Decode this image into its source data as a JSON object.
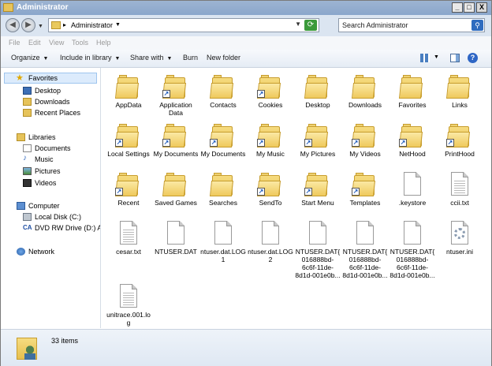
{
  "window": {
    "title": "Administrator"
  },
  "title_buttons": {
    "minimize": "_",
    "maximize": "□",
    "close": "X"
  },
  "address": {
    "path": "Administrator",
    "separator": "▸"
  },
  "search": {
    "placeholder": "Search Administrator"
  },
  "menu": {
    "file": "File",
    "edit": "Edit",
    "view": "View",
    "tools": "Tools",
    "help": "Help"
  },
  "toolbar": {
    "organize": "Organize",
    "include": "Include in library",
    "share": "Share with",
    "burn": "Burn",
    "new_folder": "New folder"
  },
  "sidebar": {
    "favorites": "Favorites",
    "desktop": "Desktop",
    "downloads": "Downloads",
    "recent": "Recent Places",
    "libraries": "Libraries",
    "documents": "Documents",
    "music": "Music",
    "pictures": "Pictures",
    "videos": "Videos",
    "computer": "Computer",
    "local_disk": "Local Disk (C:)",
    "dvd": "DVD RW Drive (D:) AP",
    "network": "Network"
  },
  "files": [
    {
      "name": "AppData",
      "type": "folder"
    },
    {
      "name": "Application Data",
      "type": "folder-shortcut"
    },
    {
      "name": "Contacts",
      "type": "folder"
    },
    {
      "name": "Cookies",
      "type": "folder-shortcut"
    },
    {
      "name": "Desktop",
      "type": "folder"
    },
    {
      "name": "Downloads",
      "type": "folder"
    },
    {
      "name": "Favorites",
      "type": "folder"
    },
    {
      "name": "Links",
      "type": "folder"
    },
    {
      "name": "Local Settings",
      "type": "folder-shortcut"
    },
    {
      "name": "My Documents",
      "type": "folder-shortcut"
    },
    {
      "name": "My Documents",
      "type": "folder-shortcut"
    },
    {
      "name": "My Music",
      "type": "folder-shortcut"
    },
    {
      "name": "My Pictures",
      "type": "folder-shortcut"
    },
    {
      "name": "My Videos",
      "type": "folder-shortcut"
    },
    {
      "name": "NetHood",
      "type": "folder-shortcut"
    },
    {
      "name": "PrintHood",
      "type": "folder-shortcut"
    },
    {
      "name": "Recent",
      "type": "folder-shortcut"
    },
    {
      "name": "Saved Games",
      "type": "folder"
    },
    {
      "name": "Searches",
      "type": "folder"
    },
    {
      "name": "SendTo",
      "type": "folder-shortcut"
    },
    {
      "name": "Start Menu",
      "type": "folder-shortcut"
    },
    {
      "name": "Templates",
      "type": "folder-shortcut"
    },
    {
      "name": ".keystore",
      "type": "file"
    },
    {
      "name": "ccii.txt",
      "type": "text"
    },
    {
      "name": "cesar.txt",
      "type": "text"
    },
    {
      "name": "NTUSER.DAT",
      "type": "file"
    },
    {
      "name": "ntuser.dat.LOG1",
      "type": "file"
    },
    {
      "name": "ntuser.dat.LOG2",
      "type": "file"
    },
    {
      "name": "NTUSER.DAT{016888bd-6c6f-11de-8d1d-001e0b...",
      "type": "file"
    },
    {
      "name": "NTUSER.DAT{016888bd-6c6f-11de-8d1d-001e0b...",
      "type": "file"
    },
    {
      "name": "NTUSER.DAT{016888bd-6c6f-11de-8d1d-001e0b...",
      "type": "file"
    },
    {
      "name": "ntuser.ini",
      "type": "settings"
    },
    {
      "name": "unitrace.001.log",
      "type": "text"
    }
  ],
  "status": {
    "count": "33 items"
  }
}
